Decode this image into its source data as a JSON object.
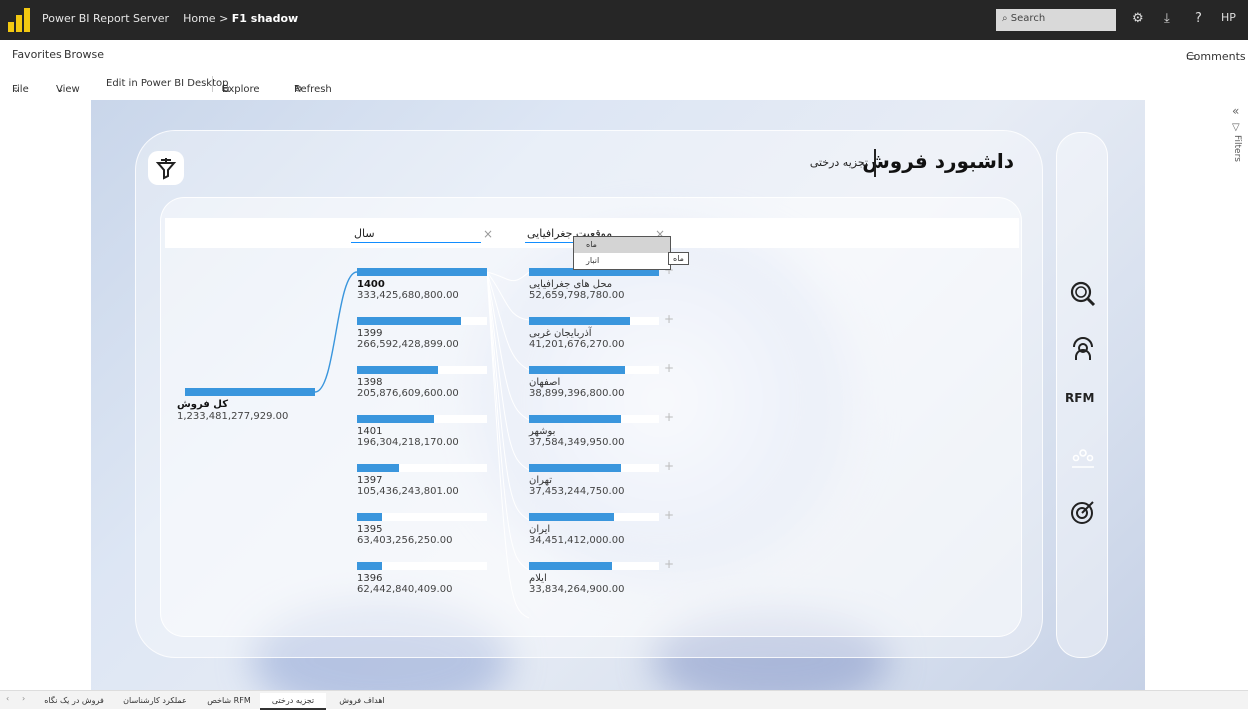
{
  "topbar": {
    "app_name": "Power BI Report Server",
    "crumb_home": "Home",
    "crumb_sep": ">",
    "crumb_current": "F1 shadow",
    "search_placeholder": "Search",
    "user_initials": "HP",
    "help_label": "?"
  },
  "menu": {
    "favorites": "Favorites",
    "browse": "Browse",
    "comments": "Comments"
  },
  "toolbar": {
    "file": "File",
    "view": "View",
    "edit_desktop": "Edit in Power BI Desktop",
    "explore": "Explore",
    "refresh": "Refresh"
  },
  "report": {
    "title": "داشبورد فروش",
    "subtitle": "تجزیه درختی",
    "level_year": "سال",
    "level_geo": "موقعیت جغرافیایی",
    "side_rfm_label": "RFM",
    "root": {
      "label": "کل فروش",
      "value": "1,233,481,277,929.00",
      "fraction": 1.0
    },
    "years": [
      {
        "label": "1400",
        "value": "333,425,680,800.00",
        "fraction": 1.0
      },
      {
        "label": "1399",
        "value": "266,592,428,899.00",
        "fraction": 0.8
      },
      {
        "label": "1398",
        "value": "205,876,609,600.00",
        "fraction": 0.62
      },
      {
        "label": "1401",
        "value": "196,304,218,170.00",
        "fraction": 0.59
      },
      {
        "label": "1397",
        "value": "105,436,243,801.00",
        "fraction": 0.32
      },
      {
        "label": "1395",
        "value": "63,403,256,250.00",
        "fraction": 0.19
      },
      {
        "label": "1396",
        "value": "62,442,840,409.00",
        "fraction": 0.19
      }
    ],
    "geo": [
      {
        "label": "محل های جغرافیایی",
        "value": "52,659,798,780.00",
        "fraction": 1.0
      },
      {
        "label": "آذربایجان غربی",
        "value": "41,201,676,270.00",
        "fraction": 0.78
      },
      {
        "label": "اصفهان",
        "value": "38,899,396,800.00",
        "fraction": 0.74
      },
      {
        "label": "بوشهر",
        "value": "37,584,349,950.00",
        "fraction": 0.71
      },
      {
        "label": "تهران",
        "value": "37,453,244,750.00",
        "fraction": 0.71
      },
      {
        "label": "ایران",
        "value": "34,451,412,000.00",
        "fraction": 0.65
      },
      {
        "label": "ایلام",
        "value": "33,834,264,900.00",
        "fraction": 0.64
      }
    ],
    "context_menu": [
      "ماه",
      "انبار"
    ],
    "tooltip": "ماه"
  },
  "filters_label": "Filters",
  "page_tabs": [
    {
      "label": "فروش در یک نگاه",
      "active": false
    },
    {
      "label": "عملکرد کارشناسان",
      "active": false
    },
    {
      "label": "شاخص RFM",
      "active": false
    },
    {
      "label": "تجزیه درختی",
      "active": true
    },
    {
      "label": "اهداف فروش",
      "active": false
    }
  ],
  "colors": {
    "bar": "#3a96dd",
    "topbar": "#262626",
    "logo": "#f2c811",
    "accent": "#118dff"
  }
}
